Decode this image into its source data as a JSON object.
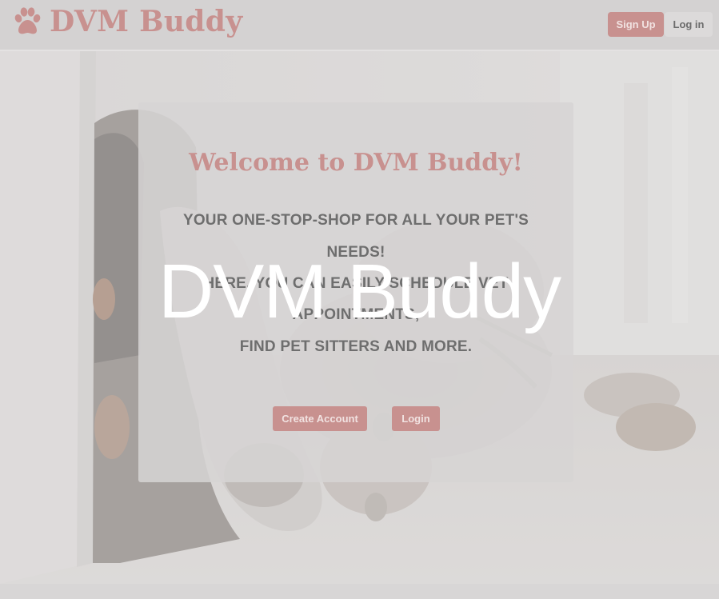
{
  "header": {
    "brand_name": "DVM Buddy",
    "brand_icon": "paw-icon",
    "signup_label": "Sign Up",
    "login_label": "Log in"
  },
  "hero": {
    "image": "dog-and-cat-lying-on-floor-photo"
  },
  "card": {
    "welcome": "Welcome to DVM Buddy!",
    "tagline_lines": [
      "YOUR ONE-STOP-SHOP FOR ALL YOUR PET'S",
      "NEEDS!",
      "HERE, YOU CAN EASILY SCHEDULE VET",
      "APPOINTMENTS,",
      "FIND PET SITTERS AND MORE."
    ],
    "create_account_label": "Create Account",
    "login_label": "Login"
  },
  "overlay": {
    "title": "DVM Buddy"
  },
  "colors": {
    "accent": "#c8918f",
    "text_gray": "#6e6e6e",
    "header_bg": "#d4d2d2",
    "overlay_text": "#ffffff"
  }
}
